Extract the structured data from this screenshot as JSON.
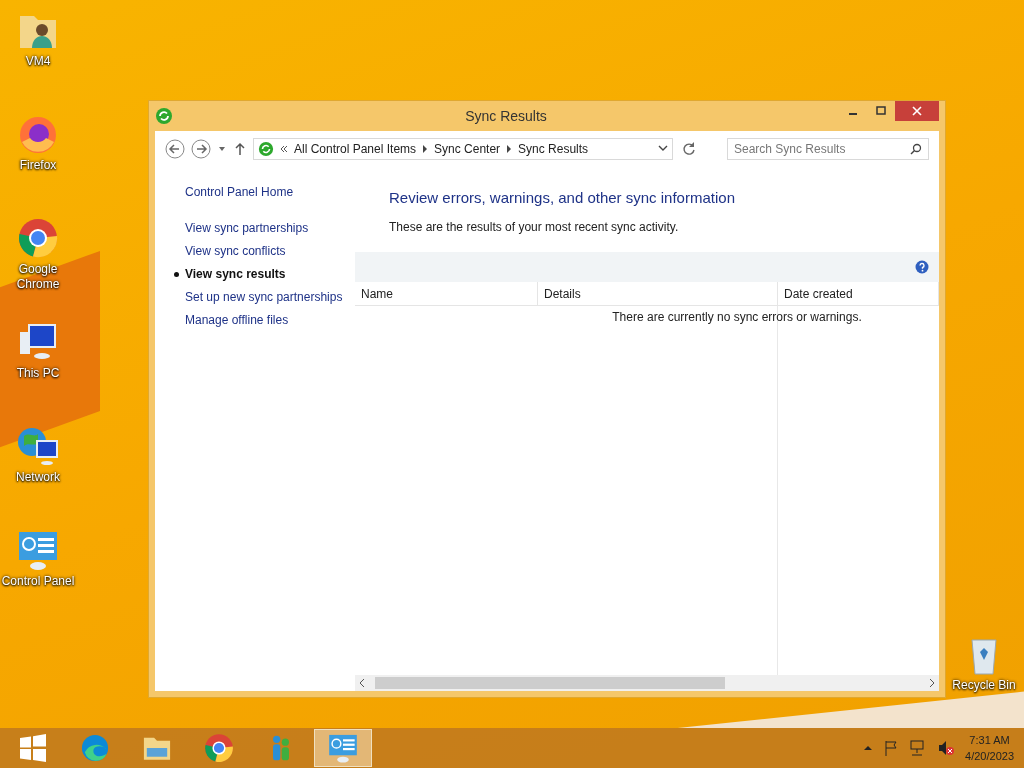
{
  "desktop_icons": [
    {
      "label": "VM4",
      "kind": "folder"
    },
    {
      "label": "Firefox",
      "kind": "firefox"
    },
    {
      "label": "Google Chrome",
      "kind": "chrome"
    },
    {
      "label": "This PC",
      "kind": "pc"
    },
    {
      "label": "Network",
      "kind": "network"
    },
    {
      "label": "Control Panel",
      "kind": "control"
    },
    {
      "label": "Recycle Bin",
      "kind": "bin"
    }
  ],
  "window": {
    "title": "Sync Results",
    "breadcrumb": [
      "All Control Panel Items",
      "Sync Center",
      "Sync Results"
    ],
    "search": {
      "placeholder": "Search Sync Results"
    },
    "sidebar": {
      "home": "Control Panel Home",
      "items": [
        {
          "label": "View sync partnerships",
          "selected": false
        },
        {
          "label": "View sync conflicts",
          "selected": false
        },
        {
          "label": "View sync results",
          "selected": true
        },
        {
          "label": "Set up new sync partnerships",
          "selected": false
        },
        {
          "label": "Manage offline files",
          "selected": false
        }
      ]
    },
    "heading": "Review errors, warnings, and other sync information",
    "description": "These are the results of your most recent sync activity.",
    "table": {
      "columns": [
        "Name",
        "Details",
        "Date created"
      ],
      "empty_message": "There are currently no sync errors or warnings."
    }
  },
  "taskbar": {
    "apps": [
      {
        "kind": "edge",
        "selected": false
      },
      {
        "kind": "explorer",
        "selected": false
      },
      {
        "kind": "chrome",
        "selected": false
      },
      {
        "kind": "people",
        "selected": false
      },
      {
        "kind": "control",
        "selected": true
      }
    ],
    "time": "7:31 AM",
    "date": "4/20/2023"
  }
}
